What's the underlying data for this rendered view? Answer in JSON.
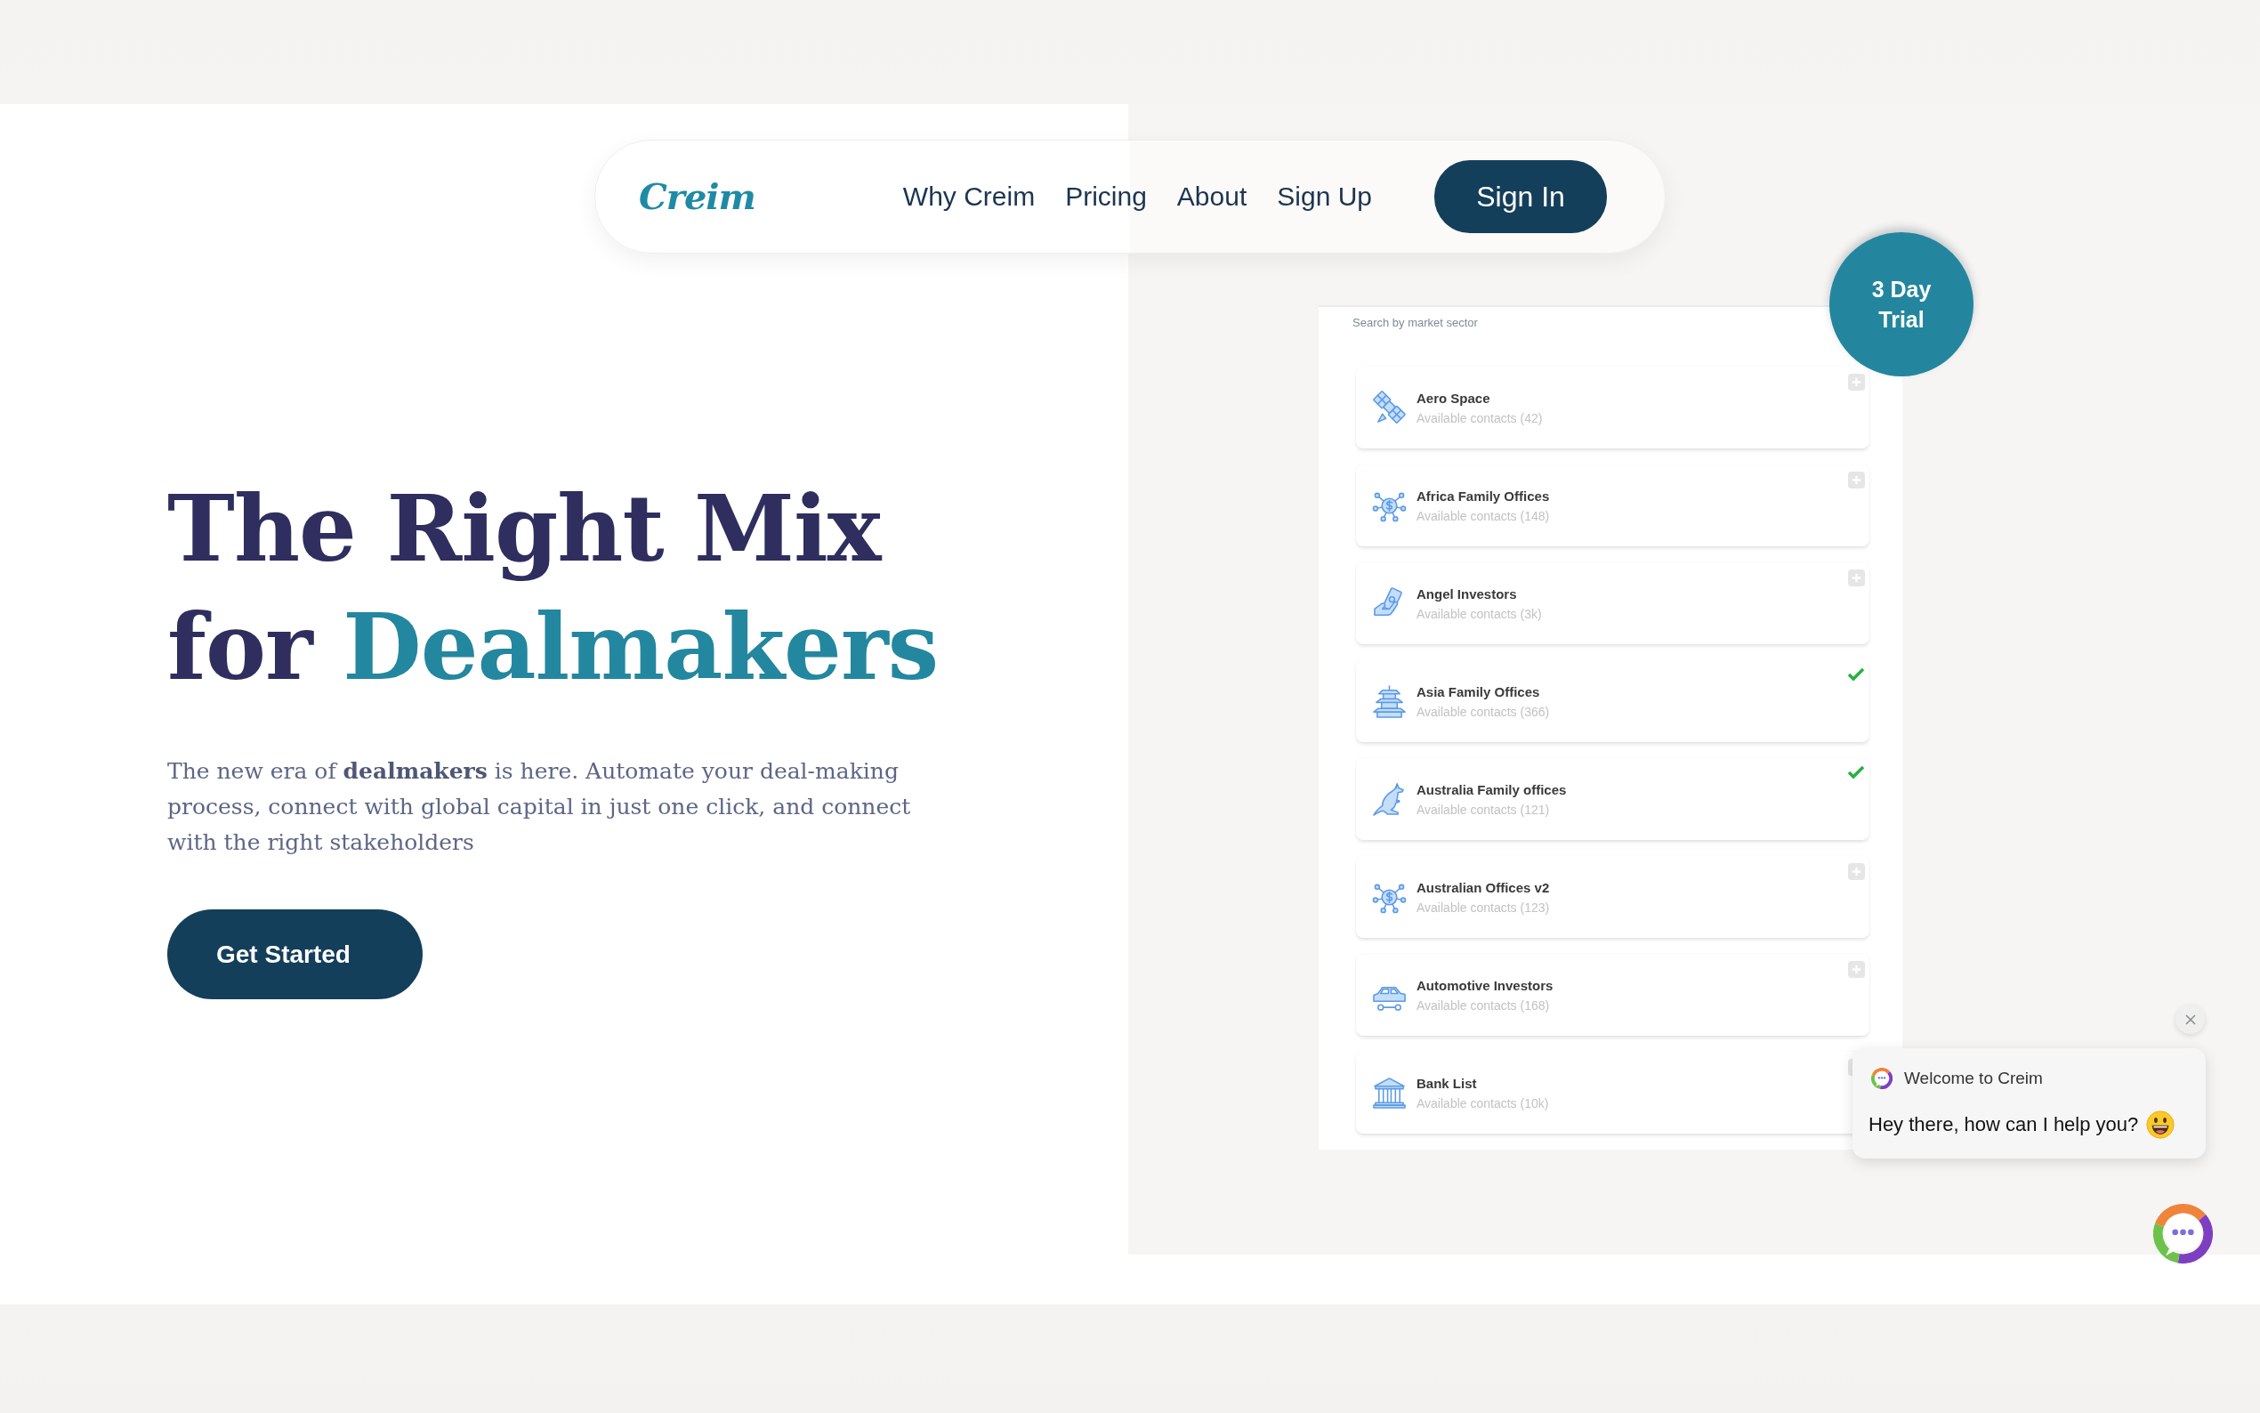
{
  "nav": {
    "logo": "Creim",
    "links": [
      "Why Creim",
      "Pricing",
      "About",
      "Sign Up"
    ],
    "sign_in": "Sign In"
  },
  "hero": {
    "heading": [
      {
        "text": "The Right Mix for",
        "accent": false
      },
      {
        "text": "Dealmakers",
        "accent": true
      }
    ],
    "intro": "The new era of **dealmakers** is here. Automate your deal-making process, connect with global capital in just one click, and connect with the right stakeholders",
    "cta": "Get Started"
  },
  "preview": {
    "trial_badge": "3 Day Trial",
    "search_label": "Search by market sector",
    "sectors": [
      {
        "name": "Aero Space",
        "contacts": "Available contacts (42)",
        "selected": false
      },
      {
        "name": "Africa Family Offices",
        "contacts": "Available contacts (148)",
        "selected": false
      },
      {
        "name": "Angel Investors",
        "contacts": "Available contacts (3k)",
        "selected": false
      },
      {
        "name": "Asia Family Offices",
        "contacts": "Available contacts (366)",
        "selected": true
      },
      {
        "name": "Australia Family offices",
        "contacts": "Available contacts (121)",
        "selected": true
      },
      {
        "name": "Australian Offices v2",
        "contacts": "Available contacts (123)",
        "selected": false
      },
      {
        "name": "Automotive Investors",
        "contacts": "Available contacts (168)",
        "selected": false
      },
      {
        "name": "Bank List",
        "contacts": "Available contacts (10k)",
        "selected": false
      }
    ]
  },
  "chat": {
    "title": "Welcome to Creim",
    "message": "Hey there, how can I help you?"
  }
}
